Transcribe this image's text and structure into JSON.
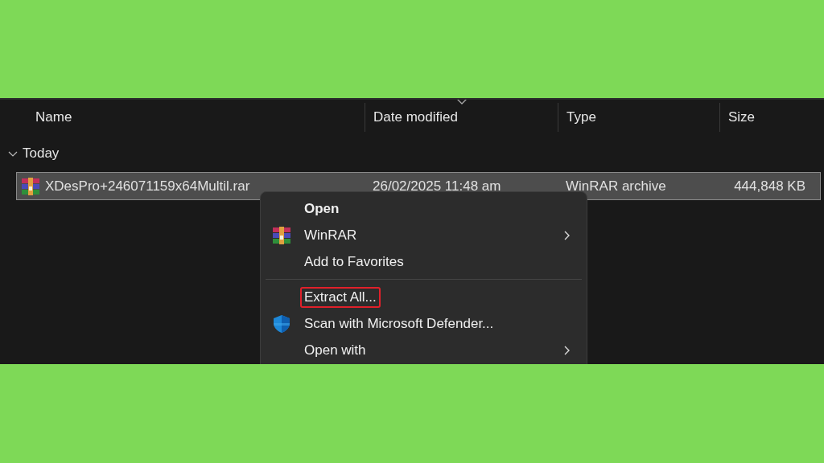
{
  "columns": [
    {
      "label": "Name",
      "sorted": false
    },
    {
      "label": "Date modified",
      "sorted": true
    },
    {
      "label": "Type",
      "sorted": false
    },
    {
      "label": "Size",
      "sorted": false
    }
  ],
  "group": {
    "label": "Today",
    "expanded": true
  },
  "files": [
    {
      "name": "XDesPro+246071159x64Multil.rar",
      "date": "26/02/2025 11:48 am",
      "type": "WinRAR archive",
      "size": "444,848 KB",
      "selected": true
    }
  ],
  "context_menu": {
    "items": [
      {
        "kind": "command",
        "label": "Open",
        "bold": true,
        "submenu": false,
        "highlighted": false
      },
      {
        "kind": "app",
        "label": "WinRAR",
        "bold": false,
        "submenu": true,
        "highlighted": false
      },
      {
        "kind": "command",
        "label": "Add to Favorites",
        "bold": false,
        "submenu": false,
        "highlighted": false
      },
      {
        "kind": "separator"
      },
      {
        "kind": "command",
        "label": "Extract All...",
        "bold": false,
        "submenu": false,
        "highlighted": true
      },
      {
        "kind": "security",
        "label": "Scan with Microsoft Defender...",
        "bold": false,
        "submenu": false,
        "highlighted": false
      },
      {
        "kind": "command",
        "label": "Open with",
        "bold": false,
        "submenu": true,
        "highlighted": false
      }
    ]
  }
}
